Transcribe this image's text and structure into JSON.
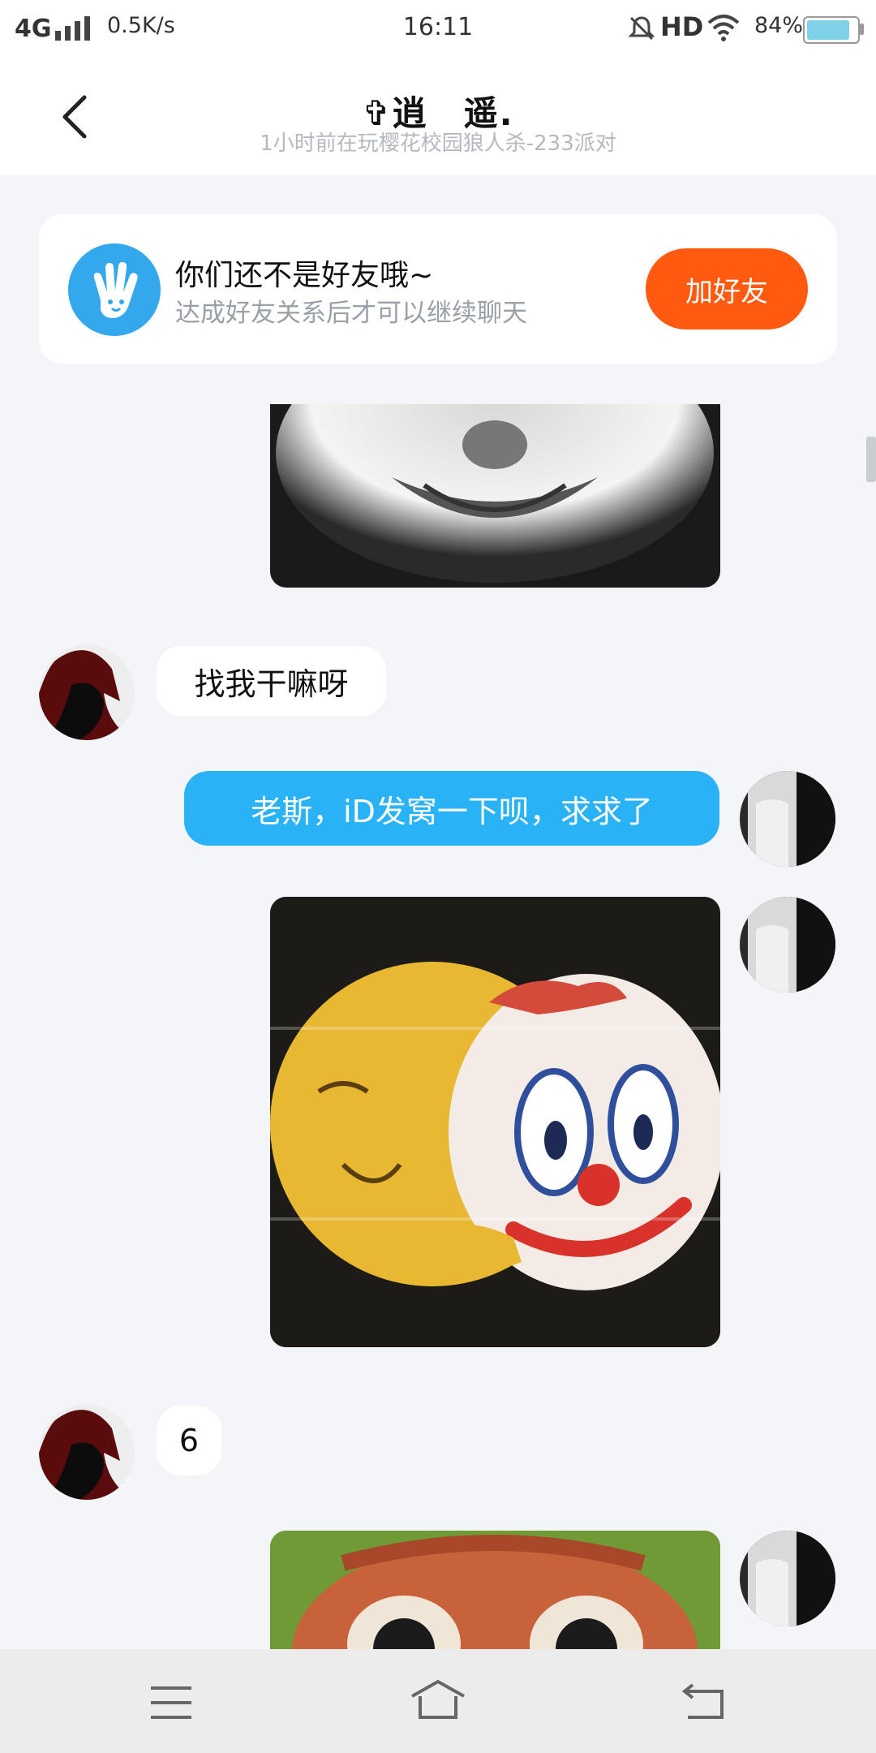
{
  "status_bar": {
    "network": "4G",
    "speed": "0.5K/s",
    "time": "16:11",
    "hd": "HD",
    "battery": "84%"
  },
  "header": {
    "title": "✞逍　遥.",
    "subtitle": "1小时前在玩樱花校园狼人杀-233派对"
  },
  "friend_banner": {
    "title": "你们还不是好友哦~",
    "subtitle": "达成好友关系后才可以继续聊天",
    "button": "加好友"
  },
  "messages": [
    {
      "side": "in",
      "type": "text",
      "text": "找我干嘛呀"
    },
    {
      "side": "out",
      "type": "text",
      "text": "老斯，iD发窝一下呗，求求了"
    },
    {
      "side": "out",
      "type": "image",
      "alt": "sticker-clown-mask"
    },
    {
      "side": "in",
      "type": "text",
      "text": "6"
    },
    {
      "side": "out",
      "type": "image",
      "alt": "sticker-cartoon-face"
    }
  ],
  "colors": {
    "accent_blue": "#29b2f6",
    "add_friend_orange": "#ff5a0f",
    "background": "#f3f5f8"
  },
  "icons": {
    "back": "chevron-left-icon",
    "menu": "menu-icon",
    "home": "home-icon",
    "return": "return-icon",
    "hand": "hand-wave-icon"
  }
}
